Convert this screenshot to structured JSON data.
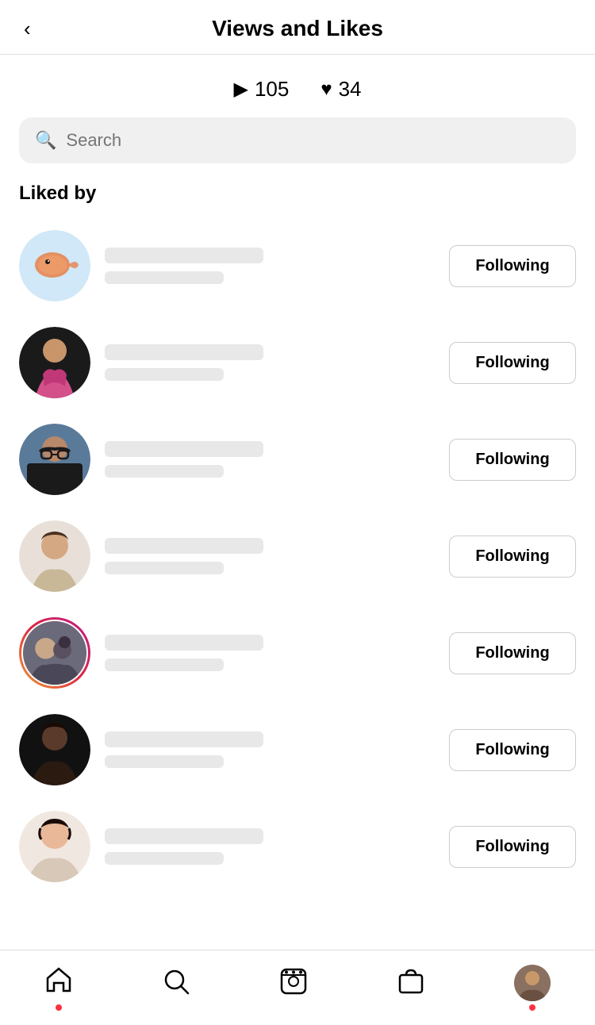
{
  "header": {
    "title": "Views and Likes",
    "back_label": "<"
  },
  "stats": {
    "views_icon": "▶",
    "views_count": "105",
    "likes_icon": "♥",
    "likes_count": "34"
  },
  "search": {
    "placeholder": "Search"
  },
  "section": {
    "label": "Liked by"
  },
  "users": [
    {
      "id": 1,
      "following_label": "Following",
      "story_ring": false,
      "avatar_type": "fish"
    },
    {
      "id": 2,
      "following_label": "Following",
      "story_ring": false,
      "avatar_type": "woman_dress"
    },
    {
      "id": 3,
      "following_label": "Following",
      "story_ring": false,
      "avatar_type": "glasses"
    },
    {
      "id": 4,
      "following_label": "Following",
      "story_ring": false,
      "avatar_type": "woman_light"
    },
    {
      "id": 5,
      "following_label": "Following",
      "story_ring": true,
      "avatar_type": "couple"
    },
    {
      "id": 6,
      "following_label": "Following",
      "story_ring": false,
      "avatar_type": "dark_person"
    },
    {
      "id": 7,
      "following_label": "Following",
      "story_ring": false,
      "avatar_type": "young_woman"
    }
  ],
  "bottom_nav": {
    "items": [
      {
        "id": "home",
        "icon": "⌂",
        "label": "Home",
        "has_dot": true
      },
      {
        "id": "search",
        "icon": "○",
        "label": "Search",
        "has_dot": false
      },
      {
        "id": "reels",
        "icon": "▷",
        "label": "Reels",
        "has_dot": false
      },
      {
        "id": "shop",
        "icon": "◻",
        "label": "Shop",
        "has_dot": false
      },
      {
        "id": "profile",
        "icon": "avatar",
        "label": "Profile",
        "has_dot": true
      }
    ]
  }
}
